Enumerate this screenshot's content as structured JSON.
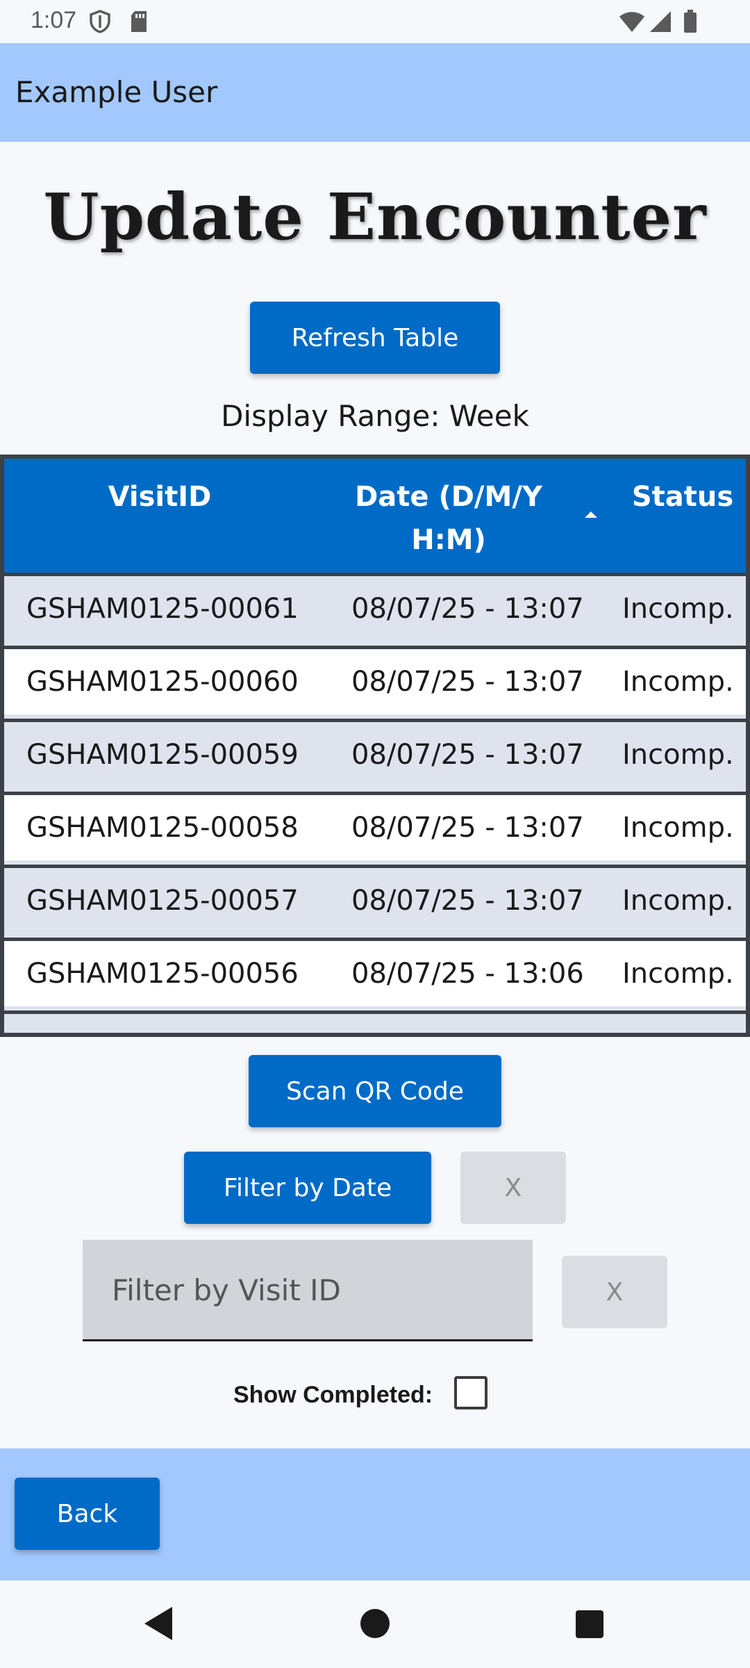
{
  "status": {
    "time": "1:07"
  },
  "header": {
    "user": "Example User"
  },
  "title": "Update Encounter",
  "buttons": {
    "refresh": "Refresh Table",
    "scan_qr": "Scan QR Code",
    "filter_date": "Filter by Date",
    "clear": "X",
    "back": "Back"
  },
  "display_range": "Display Range: Week",
  "table": {
    "headers": {
      "visit_id": "VisitID",
      "date_line1": "Date (D/M/Y",
      "date_line2": "H:M)",
      "status": "Status"
    },
    "sort": {
      "column": "date",
      "direction": "ascending"
    },
    "rows": [
      {
        "visit_id": "GSHAM0125-00061",
        "date": "08/07/25 - 13:07",
        "status": "Incomp."
      },
      {
        "visit_id": "GSHAM0125-00060",
        "date": "08/07/25 - 13:07",
        "status": "Incomp."
      },
      {
        "visit_id": "GSHAM0125-00059",
        "date": "08/07/25 - 13:07",
        "status": "Incomp."
      },
      {
        "visit_id": "GSHAM0125-00058",
        "date": "08/07/25 - 13:07",
        "status": "Incomp."
      },
      {
        "visit_id": "GSHAM0125-00057",
        "date": "08/07/25 - 13:07",
        "status": "Incomp."
      },
      {
        "visit_id": "GSHAM0125-00056",
        "date": "08/07/25 - 13:06",
        "status": "Incomp."
      }
    ]
  },
  "filter": {
    "visit_id_placeholder": "Filter by Visit ID",
    "visit_id_value": ""
  },
  "show_completed": {
    "label": "Show Completed:",
    "checked": false
  },
  "colors": {
    "primary": "#006bc7",
    "header_bg": "#a2c8fd",
    "row_alt": "#dfe3ee"
  },
  "icons": [
    "shield-icon",
    "sd-card-icon",
    "wifi-icon",
    "signal-icon",
    "battery-icon",
    "back-nav-icon",
    "home-nav-icon",
    "recents-nav-icon"
  ]
}
